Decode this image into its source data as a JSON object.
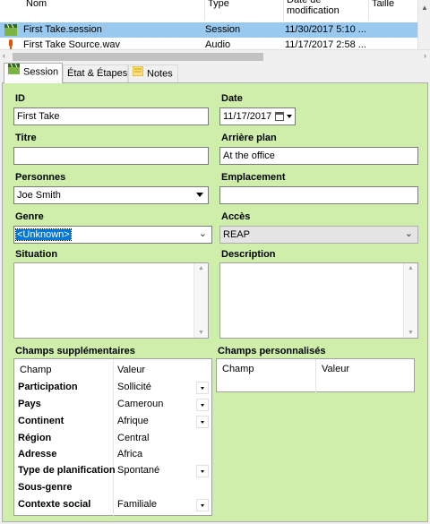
{
  "file_list": {
    "columns": [
      "Nom",
      "Type",
      "Date de modification",
      "Taille"
    ],
    "rows": [
      {
        "name": "First Take.session",
        "type": "Session",
        "date": "11/30/2017 5:10 ...",
        "size": "",
        "icon": "session-icon",
        "selected": true
      },
      {
        "name": "First Take Source.wav",
        "type": "Audio",
        "date": "11/17/2017 2:58 ...",
        "size": "",
        "icon": "audio-icon",
        "selected": false
      }
    ]
  },
  "tabs": [
    {
      "label": "Session",
      "icon": "session-icon",
      "active": true
    },
    {
      "label": "État & Étapes",
      "icon": "",
      "active": false
    },
    {
      "label": "Notes",
      "icon": "notes-icon",
      "active": false
    }
  ],
  "form": {
    "id": {
      "label": "ID",
      "value": "First Take"
    },
    "date": {
      "label": "Date",
      "value": "11/17/2017"
    },
    "title": {
      "label": "Titre",
      "value": ""
    },
    "background": {
      "label": "Arrière plan",
      "value": "At the office"
    },
    "people": {
      "label": "Personnes",
      "value": "Joe Smith"
    },
    "location": {
      "label": "Emplacement",
      "value": ""
    },
    "genre": {
      "label": "Genre",
      "value": "<Unknown>"
    },
    "access": {
      "label": "Accès",
      "value": "REAP"
    },
    "situation": {
      "label": "Situation",
      "value": ""
    },
    "description": {
      "label": "Description",
      "value": ""
    }
  },
  "extra_fields": {
    "label": "Champs supplémentaires",
    "col_field": "Champ",
    "col_value": "Valeur",
    "rows": [
      {
        "name": "Participation",
        "value": "Sollicité",
        "dropdown": true
      },
      {
        "name": "Pays",
        "value": "Cameroun",
        "dropdown": true
      },
      {
        "name": "Continent",
        "value": "Afrique",
        "dropdown": true
      },
      {
        "name": "Région",
        "value": "Central",
        "dropdown": false
      },
      {
        "name": "Adresse",
        "value": "Africa",
        "dropdown": false
      },
      {
        "name": "Type de planification",
        "value": "Spontané",
        "dropdown": true
      },
      {
        "name": "Sous-genre",
        "value": "",
        "dropdown": false
      },
      {
        "name": "Contexte social",
        "value": "Familiale",
        "dropdown": true
      }
    ]
  },
  "custom_fields": {
    "label": "Champs personnalisés",
    "col_field": "Champ",
    "col_value": "Valeur"
  },
  "colors": {
    "panel": "#ceeeaa",
    "selection": "#99c9ef",
    "highlight": "#0078d7"
  }
}
